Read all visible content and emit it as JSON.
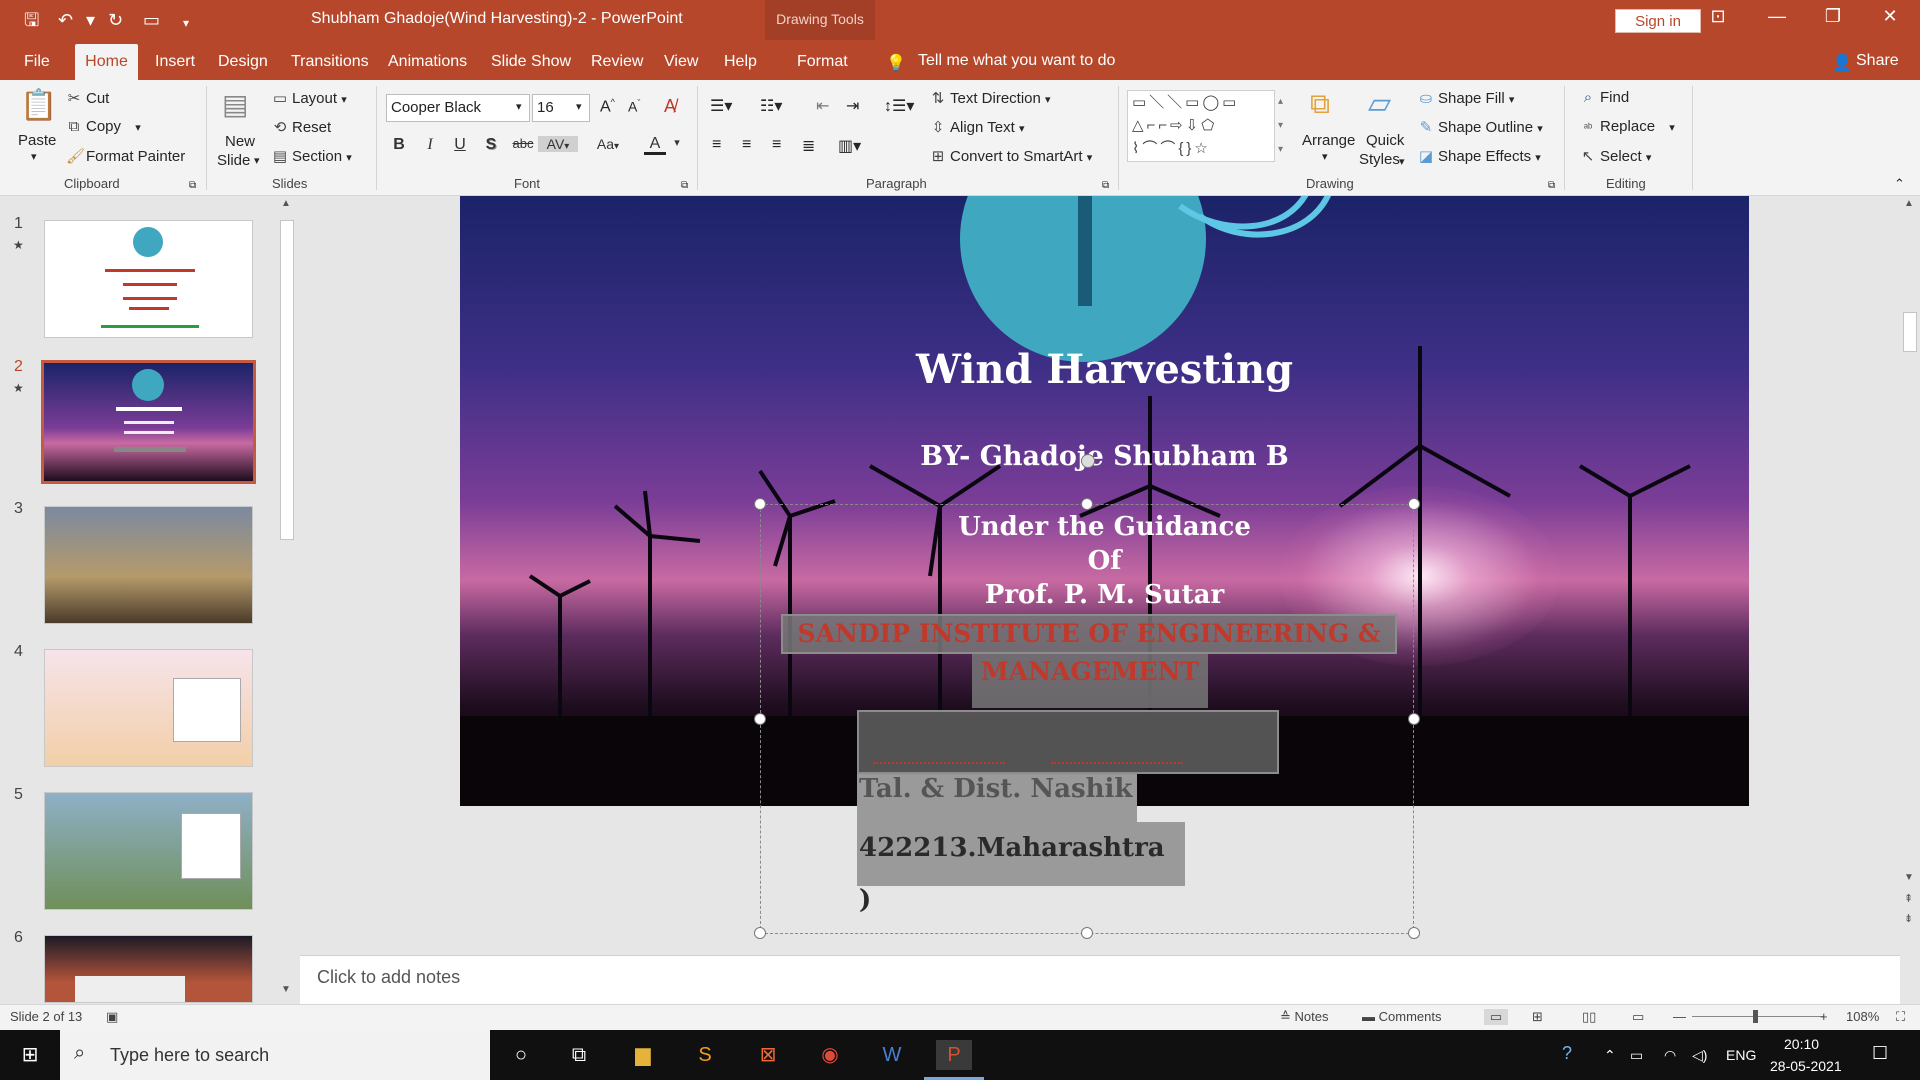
{
  "window": {
    "title": "Shubham Ghadoje(Wind Harvesting)-2  -  PowerPoint",
    "context_group": "Drawing Tools",
    "signin": "Sign in",
    "share": "Share",
    "tell_me": "Tell me what you want to do"
  },
  "qa_icons": [
    "save-icon",
    "undo-icon",
    "redo-icon",
    "present-icon",
    "customize-icon"
  ],
  "tabs": [
    "File",
    "Home",
    "Insert",
    "Design",
    "Transitions",
    "Animations",
    "Slide Show",
    "Review",
    "View",
    "Help",
    "Format"
  ],
  "active_tab": "Home",
  "clipboard": {
    "paste": "Paste",
    "cut": "Cut",
    "copy": "Copy",
    "format_painter": "Format Painter",
    "group": "Clipboard"
  },
  "slides_group": {
    "new_slide": "New",
    "new_slide2": "Slide",
    "layout": "Layout",
    "reset": "Reset",
    "section": "Section",
    "group": "Slides"
  },
  "font": {
    "name": "Cooper Black",
    "size": "16",
    "group": "Font",
    "bold": "B",
    "italic": "I",
    "underline": "U",
    "shadow": "S",
    "strike": "abc",
    "spacing": "AV",
    "case": "Aa",
    "color": "A"
  },
  "paragraph": {
    "text_direction": "Text Direction",
    "align_text": "Align Text",
    "smartart": "Convert to SmartArt",
    "group": "Paragraph"
  },
  "drawing": {
    "arrange": "Arrange",
    "quick_styles": "Quick",
    "quick_styles2": "Styles",
    "shape_fill": "Shape Fill",
    "shape_outline": "Shape Outline",
    "shape_effects": "Shape Effects",
    "group": "Drawing"
  },
  "editing": {
    "find": "Find",
    "replace": "Replace",
    "select": "Select",
    "group": "Editing"
  },
  "thumbnails": [
    {
      "num": "1",
      "star": "★"
    },
    {
      "num": "2",
      "star": "★"
    },
    {
      "num": "3",
      "star": ""
    },
    {
      "num": "4",
      "star": ""
    },
    {
      "num": "5",
      "star": ""
    },
    {
      "num": "6",
      "star": ""
    }
  ],
  "slide": {
    "title": "Wind Harvesting",
    "by": "BY- Ghadoje Shubham B",
    "guidance": [
      "Under the Guidance",
      "Of",
      "Prof. P. M. Sutar"
    ],
    "institute": "SANDIP INSTITUTE OF ENGINEERING &",
    "institute2": "MANAGEMENT",
    "address_partial": "Tal. & Dist. Nashik",
    "address": "422213.Maharashtra )"
  },
  "notes_placeholder": "Click to add notes",
  "status": {
    "slide_of": "Slide 2 of 13",
    "notes": "Notes",
    "comments": "Comments",
    "zoom": "108%"
  },
  "taskbar": {
    "search": "Type here to search",
    "lang": "ENG",
    "time": "20:10",
    "date": "28-05-2021"
  },
  "colors": {
    "accent": "#b7472a",
    "ribbon": "#f3f3f3"
  }
}
